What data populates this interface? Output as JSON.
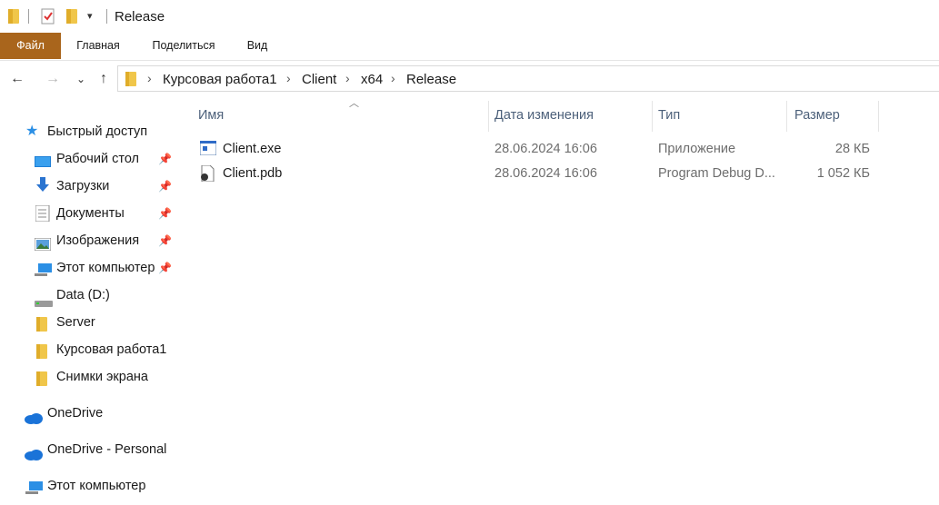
{
  "window": {
    "title": "Release"
  },
  "ribbon": {
    "tabs": [
      "Файл",
      "Главная",
      "Поделиться",
      "Вид"
    ]
  },
  "address": {
    "path": [
      "Курсовая работа1",
      "Client",
      "x64",
      "Release"
    ]
  },
  "sidebar": {
    "quick_access": "Быстрый доступ",
    "pinned": [
      {
        "label": "Рабочий стол",
        "icon": "desktop-icon"
      },
      {
        "label": "Загрузки",
        "icon": "download-icon"
      },
      {
        "label": "Документы",
        "icon": "documents-icon"
      },
      {
        "label": "Изображения",
        "icon": "pictures-icon"
      },
      {
        "label": "Этот компьютер",
        "icon": "computer-icon"
      }
    ],
    "items": [
      {
        "label": "Data (D:)",
        "icon": "drive-icon"
      },
      {
        "label": "Server",
        "icon": "folder-icon"
      },
      {
        "label": "Курсовая работа1",
        "icon": "folder-icon"
      },
      {
        "label": "Снимки экрана",
        "icon": "folder-icon"
      }
    ],
    "onedrive": "OneDrive",
    "onedrive_personal": "OneDrive - Personal",
    "this_pc": "Этот компьютер"
  },
  "columns": {
    "name": "Имя",
    "date": "Дата изменения",
    "type": "Тип",
    "size": "Размер"
  },
  "files": [
    {
      "name": "Client.exe",
      "date": "28.06.2024 16:06",
      "type": "Приложение",
      "size": "28 КБ",
      "icon": "exe-icon"
    },
    {
      "name": "Client.pdb",
      "date": "28.06.2024 16:06",
      "type": "Program Debug D...",
      "size": "1 052 КБ",
      "icon": "pdb-icon"
    }
  ],
  "colors": {
    "file_tab": "#a9651c",
    "header_text": "#4c607a",
    "folder": "#f0c64a",
    "onedrive": "#1a73d8"
  }
}
